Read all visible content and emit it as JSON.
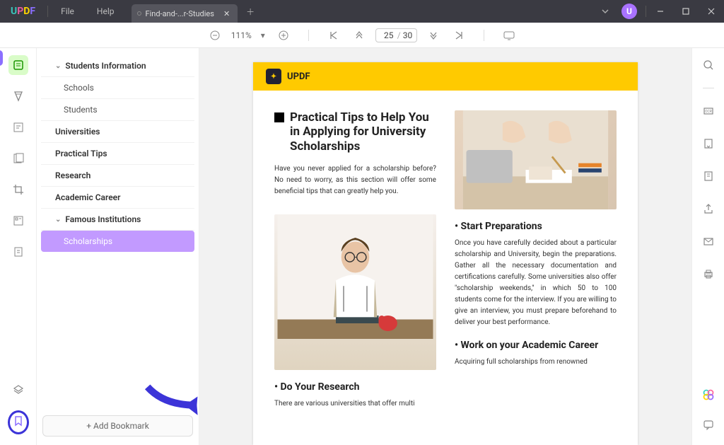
{
  "titleBar": {
    "menus": [
      "File",
      "Help"
    ],
    "tabName": "Find-and-...r-Studies",
    "avatar": "U"
  },
  "toolbar": {
    "zoom": "111%",
    "currentPage": "25",
    "totalPages": "30"
  },
  "bookmarks": {
    "items": [
      {
        "label": "Students Information",
        "level": 1,
        "bold": true,
        "expand": true
      },
      {
        "label": "Schools",
        "level": 2
      },
      {
        "label": "Students",
        "level": 2
      },
      {
        "label": "Universities",
        "level": 1,
        "bold": true
      },
      {
        "label": "Practical Tips",
        "level": 1,
        "bold": true
      },
      {
        "label": "Research",
        "level": 1,
        "bold": true
      },
      {
        "label": "Academic Career",
        "level": 1,
        "bold": true
      },
      {
        "label": "Famous Institutions",
        "level": 1,
        "bold": true,
        "expand": true
      },
      {
        "label": "Scholarships",
        "level": 2,
        "selected": true
      }
    ],
    "addLabel": "+ Add Bookmark"
  },
  "doc": {
    "brand": "UPDF",
    "title": "Practical Tips to Help You in Applying for University Scholarships",
    "intro": "Have you never applied for a scholarship before? No need to worry, as this section will offer some beneficial tips that can greatly help you.",
    "sec1": "Do Your Research",
    "sec1text": "There are various universities that offer multi",
    "sec2": "Start Preparations",
    "sec2text": "Once you have carefully decided about a particular scholarship and University, begin the preparations. Gather all the necessary documentation and certifications carefully. Some universities also offer \"scholarship weekends,\" in which 50 to 100 students come for the interview. If you are willing to give an interview, you must prepare beforehand to deliver your best performance.",
    "sec3": "Work on your Academic Career",
    "sec3text": "Acquiring full scholarships from renowned"
  }
}
